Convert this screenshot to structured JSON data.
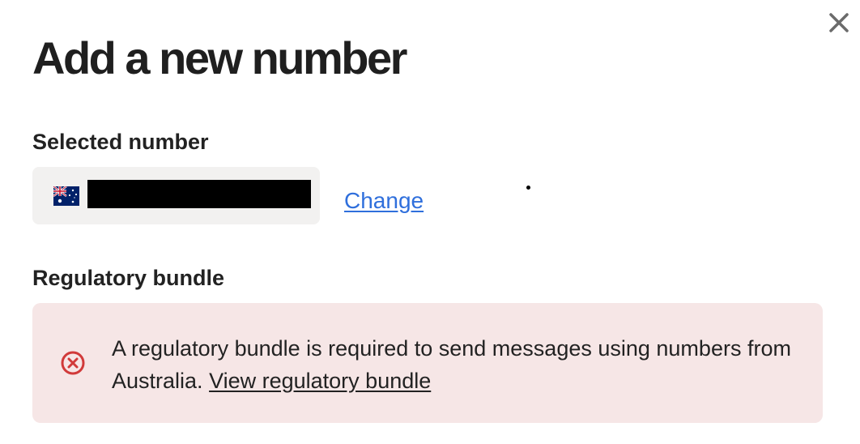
{
  "dialog": {
    "title": "Add a new number",
    "close_icon": "close-icon"
  },
  "selected_number": {
    "label": "Selected number",
    "flag_icon": "australia-flag-icon",
    "number_value": "",
    "change_label": "Change"
  },
  "regulatory_bundle": {
    "label": "Regulatory bundle",
    "alert": {
      "icon": "error-circle-icon",
      "message": "A regulatory bundle is required to send messages using numbers from Australia.",
      "link_label": "View regulatory bundle"
    }
  },
  "colors": {
    "link": "#2f6fdc",
    "alert_background": "#f6e6e6",
    "error_icon": "#d13a3a",
    "number_box_background": "#f2f1f0"
  }
}
